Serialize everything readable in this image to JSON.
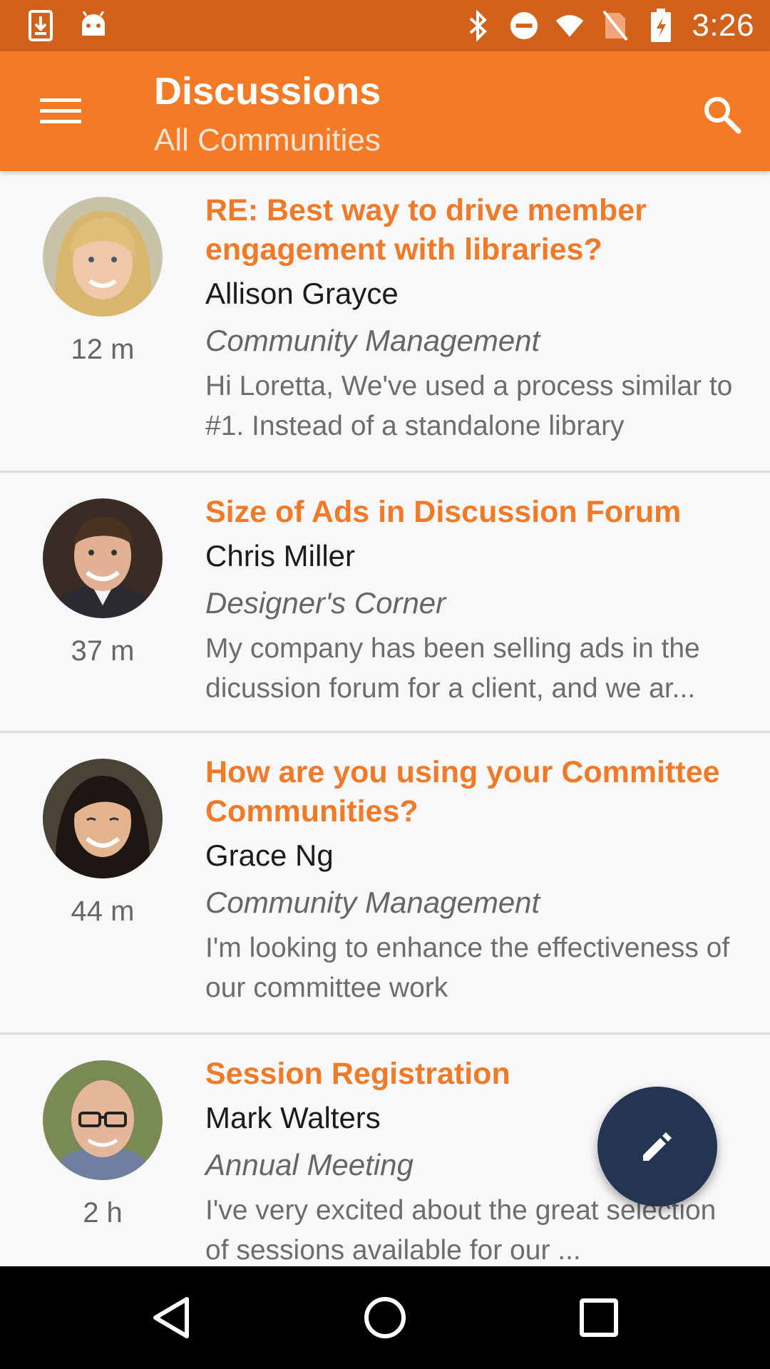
{
  "status_bar": {
    "time": "3:26",
    "icons": [
      "download-icon",
      "android-icon",
      "bluetooth-icon",
      "do-not-disturb-icon",
      "wifi-icon",
      "no-sim-icon",
      "battery-charging-icon"
    ]
  },
  "app_bar": {
    "title": "Discussions",
    "subtitle": "All Communities",
    "menu_icon": "menu-icon",
    "search_icon": "search-icon"
  },
  "colors": {
    "status_bar": "#d2611c",
    "app_bar": "#f37a26",
    "subject": "#f07a28",
    "fab": "#243453"
  },
  "discussions": [
    {
      "subject": "RE: Best way to drive member engagement with libraries?",
      "author": "Allison Grayce",
      "community": "Community Management",
      "excerpt": "Hi Loretta, We've used a process similar to #1. Instead of a standalone library",
      "time": "12 m"
    },
    {
      "subject": "Size of Ads in Discussion Forum",
      "author": "Chris Miller",
      "community": "Designer's Corner",
      "excerpt": "My company has been selling ads in the dicussion forum for a client, and we ar...",
      "time": "37 m"
    },
    {
      "subject": "How are you using your Committee Communities?",
      "author": "Grace Ng",
      "community": "Community Management",
      "excerpt": "I'm looking to enhance the effectiveness of our committee work",
      "time": "44 m"
    },
    {
      "subject": "Session Registration",
      "author": "Mark Walters",
      "community": "Annual Meeting",
      "excerpt": "I've very excited about the great selection of sessions available for our ...",
      "time": "2 h"
    }
  ],
  "fab": {
    "icon": "pencil-icon"
  },
  "nav_bar": {
    "icons": [
      "back-icon",
      "home-icon",
      "recents-icon"
    ]
  }
}
